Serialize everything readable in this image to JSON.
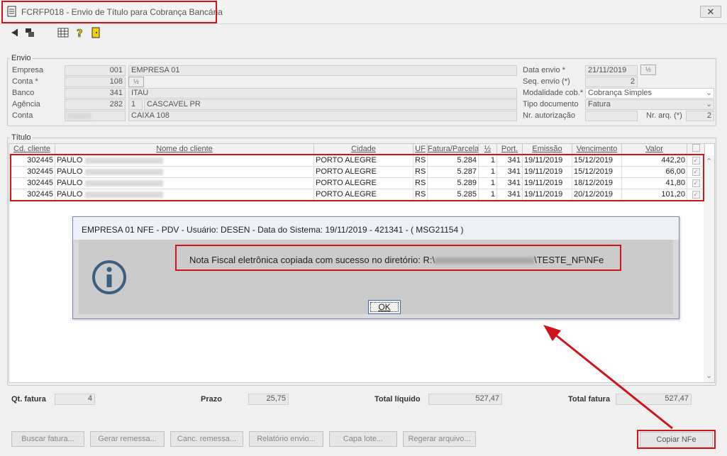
{
  "window": {
    "title": "FCRFP018 - Envio de Título para Cobrança Bancária",
    "close": "✕"
  },
  "envio": {
    "group_label": "Envio",
    "empresa_label": "Empresa",
    "empresa_code": "001",
    "empresa_name": "EMPRESA 01",
    "conta_label": "Conta *",
    "conta_value": "108",
    "banco_label": "Banco",
    "banco_code": "341",
    "banco_name": "ITAU",
    "agencia_label": "Agência",
    "agencia_code": "282",
    "agencia_dv": "1",
    "agencia_city": "CASCAVEL PR",
    "conta2_label": "Conta",
    "conta2_name": "CAIXA 108",
    "data_envio_label": "Data envio *",
    "data_envio": "21/11/2019",
    "seq_label": "Seq. envio (*)",
    "seq_value": "2",
    "modalidade_label": "Modalidade cob.*",
    "modalidade_value": "Cobrança Simples",
    "tipo_label": "Tipo documento",
    "tipo_value": "Fatura",
    "nr_aut_label": "Nr. autorização",
    "nr_arq_label": "Nr. arq. (*)",
    "nr_arq_value": "2"
  },
  "titulo": {
    "group_label": "Título",
    "columns": [
      "Cd. cliente",
      "Nome do cliente",
      "Cidade",
      "UF",
      "Fatura/Parcela",
      "½",
      "Port.",
      "Emissão",
      "Vencimento",
      "Valor"
    ],
    "rows": [
      {
        "cd": "302445",
        "nome": "PAULO",
        "cidade": "PORTO ALEGRE",
        "uf": "RS",
        "fatura": "5.284",
        "parc": "1",
        "port": "341",
        "emissao": "19/11/2019",
        "venc": "15/12/2019",
        "valor": "442,20"
      },
      {
        "cd": "302445",
        "nome": "PAULO",
        "cidade": "PORTO ALEGRE",
        "uf": "RS",
        "fatura": "5.287",
        "parc": "1",
        "port": "341",
        "emissao": "19/11/2019",
        "venc": "15/12/2019",
        "valor": "66,00"
      },
      {
        "cd": "302445",
        "nome": "PAULO",
        "cidade": "PORTO ALEGRE",
        "uf": "RS",
        "fatura": "5.289",
        "parc": "1",
        "port": "341",
        "emissao": "19/11/2019",
        "venc": "18/12/2019",
        "valor": "41,80"
      },
      {
        "cd": "302445",
        "nome": "PAULO",
        "cidade": "PORTO ALEGRE",
        "uf": "RS",
        "fatura": "5.285",
        "parc": "1",
        "port": "341",
        "emissao": "19/11/2019",
        "venc": "20/12/2019",
        "valor": "101,20"
      }
    ]
  },
  "dialog": {
    "title": "EMPRESA 01 NFE - PDV - Usuário: DESEN - Data do Sistema: 19/11/2019 - 421341 - ( MSG21154 )",
    "message_prefix": "Nota Fiscal eletrônica copiada com sucesso no diretório: R:\\",
    "message_suffix": "\\TESTE_NF\\NFe",
    "ok": "OK"
  },
  "totals": {
    "qt_fatura_label": "Qt. fatura",
    "qt_fatura": "4",
    "prazo_label": "Prazo",
    "prazo": "25,75",
    "total_liquido_label": "Total líquido",
    "total_liquido": "527,47",
    "total_fatura_label": "Total fatura",
    "total_fatura": "527,47"
  },
  "buttons": {
    "buscar": "Buscar fatura...",
    "gerar": "Gerar remessa...",
    "canc": "Canc. remessa...",
    "relatorio": "Relatório envio...",
    "capa": "Capa lote...",
    "regerar": "Regerar arquivo...",
    "copiar": "Copiar NFe"
  },
  "annotation_color": "#d0141b"
}
